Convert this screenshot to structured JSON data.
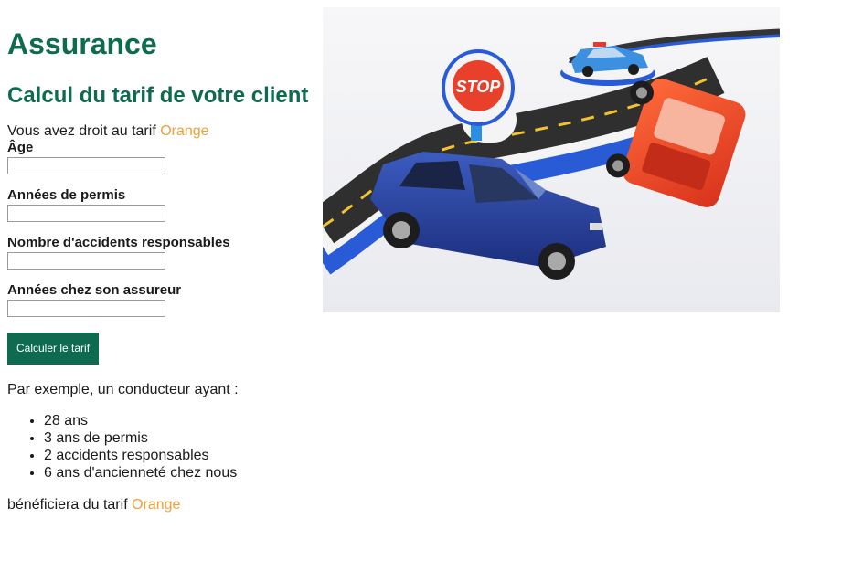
{
  "page": {
    "title": "Assurance",
    "subtitle": "Calcul du tarif de votre client",
    "intro_prefix": "Vous avez droit au tarif ",
    "intro_tarif": "Orange"
  },
  "form": {
    "fields": [
      {
        "label": "Âge",
        "value": ""
      },
      {
        "label": "Années de permis",
        "value": ""
      },
      {
        "label": "Nombre d'accidents responsables",
        "value": ""
      },
      {
        "label": "Années chez son assureur",
        "value": ""
      }
    ],
    "submit_label": "Calculer le tarif"
  },
  "example": {
    "intro": "Par exemple, un conducteur ayant :",
    "items": [
      "28 ans",
      "3 ans de permis",
      "2 accidents responsables",
      "6 ans d'ancienneté chez nous"
    ],
    "result_prefix": "bénéficiera du tarif ",
    "result_tarif": "Orange"
  },
  "image": {
    "stop_sign_text": "STOP"
  },
  "colors": {
    "heading": "#0e6b4f",
    "tarif_orange": "#f0a03a",
    "button_bg": "#0e6b4f"
  }
}
